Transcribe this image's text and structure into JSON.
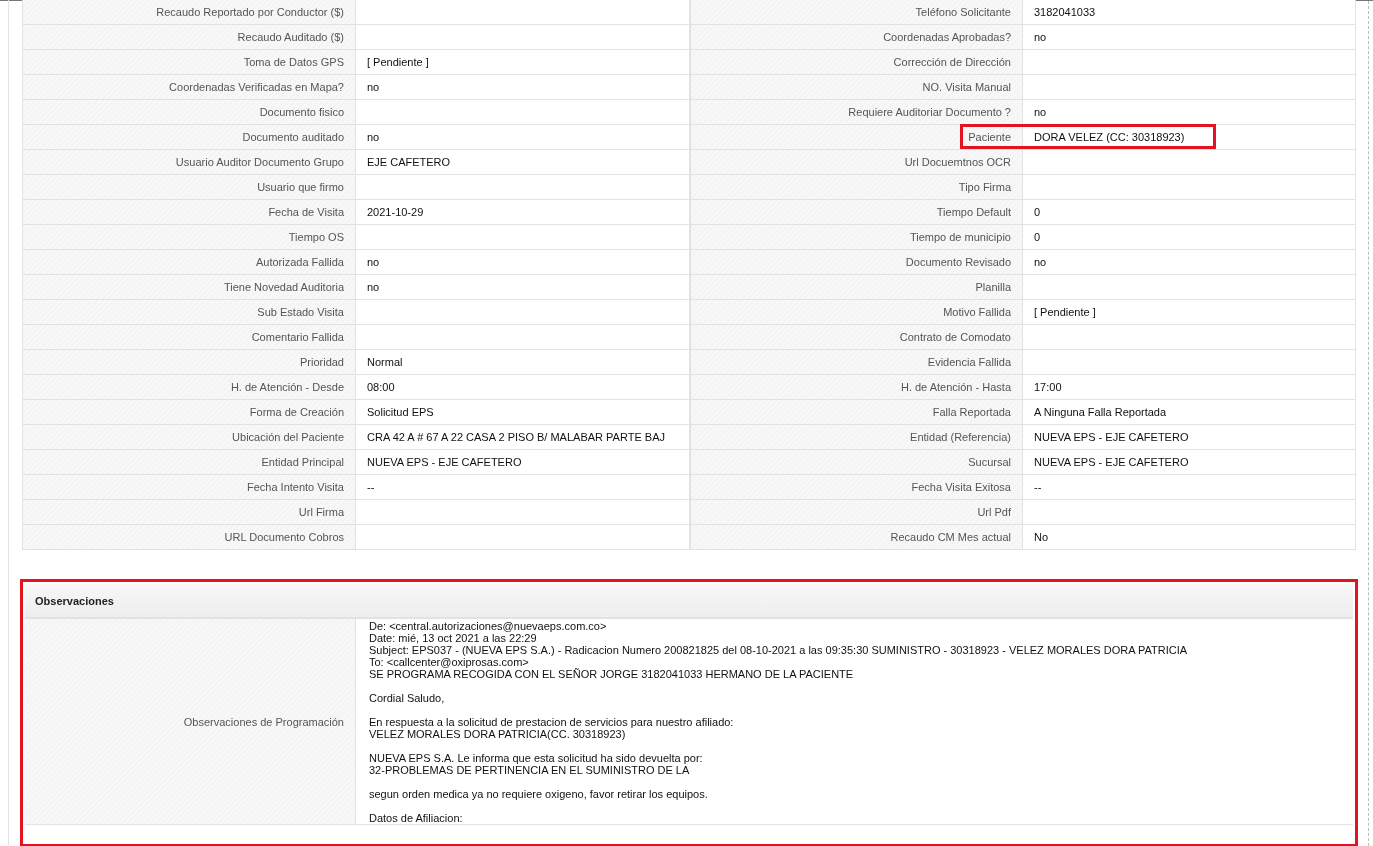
{
  "details": {
    "rows": [
      {
        "left": {
          "label": "Recaudo Reportado por Conductor ($)"
        },
        "right": {
          "label": "Teléfono Solicitante",
          "value": "3182041033"
        }
      },
      {
        "left": {
          "label": "Recaudo Auditado ($)"
        },
        "right": {
          "label": "Coordenadas Aprobadas?",
          "value": "no"
        }
      },
      {
        "left": {
          "label": "Toma de Datos GPS",
          "value": "[ Pendiente ]"
        },
        "right": {
          "label": "Corrección de Dirección"
        }
      },
      {
        "left": {
          "label": "Coordenadas Verificadas en Mapa?",
          "value": "no"
        },
        "right": {
          "label": "NO. Visita Manual"
        }
      },
      {
        "left": {
          "label": "Documento fisico"
        },
        "right": {
          "label": "Requiere Auditoriar Documento ?",
          "value": "no"
        }
      },
      {
        "left": {
          "label": "Documento auditado",
          "value": "no"
        },
        "right": {
          "label": "Paciente",
          "value": "DORA VELEZ (CC: 30318923)",
          "highlighted": true
        }
      },
      {
        "left": {
          "label": "Usuario Auditor Documento Grupo",
          "value": "EJE CAFETERO"
        },
        "right": {
          "label": "Url Docuemtnos OCR"
        }
      },
      {
        "left": {
          "label": "Usuario que firmo"
        },
        "right": {
          "label": "Tipo Firma"
        }
      },
      {
        "left": {
          "label": "Fecha de Visita",
          "value": "2021-10-29"
        },
        "right": {
          "label": "Tiempo Default",
          "value": "0"
        }
      },
      {
        "left": {
          "label": "Tiempo OS"
        },
        "right": {
          "label": "Tiempo de municipio",
          "value": "0"
        }
      },
      {
        "left": {
          "label": "Autorizada Fallida",
          "value": "no"
        },
        "right": {
          "label": "Documento Revisado",
          "value": "no"
        }
      },
      {
        "left": {
          "label": "Tiene Novedad Auditoria",
          "value": "no"
        },
        "right": {
          "label": "Planilla"
        }
      },
      {
        "left": {
          "label": "Sub Estado Visita"
        },
        "right": {
          "label": "Motivo Fallida",
          "value": "[ Pendiente ]"
        }
      },
      {
        "left": {
          "label": "Comentario Fallida"
        },
        "right": {
          "label": "Contrato de Comodato"
        }
      },
      {
        "left": {
          "label": "Prioridad",
          "value": "Normal"
        },
        "right": {
          "label": "Evidencia Fallida"
        }
      },
      {
        "left": {
          "label": "H. de Atención - Desde",
          "value": "08:00"
        },
        "right": {
          "label": "H. de Atención - Hasta",
          "value": "17:00"
        }
      },
      {
        "left": {
          "label": "Forma de Creación",
          "value": "Solicitud EPS"
        },
        "right": {
          "label": "Falla Reportada",
          "value": "A Ninguna Falla Reportada"
        }
      },
      {
        "left": {
          "label": "Ubicación del Paciente",
          "value": "CRA 42 A # 67 A 22 CASA 2 PISO B/ MALABAR PARTE BAJ"
        },
        "right": {
          "label": "Entidad (Referencia)",
          "value": "NUEVA EPS - EJE CAFETERO"
        }
      },
      {
        "left": {
          "label": "Entidad Principal",
          "value": "NUEVA EPS - EJE CAFETERO"
        },
        "right": {
          "label": "Sucursal",
          "value": "NUEVA EPS - EJE CAFETERO"
        }
      },
      {
        "left": {
          "label": "Fecha Intento Visita",
          "value": "--"
        },
        "right": {
          "label": "Fecha Visita Exitosa",
          "value": "--"
        }
      },
      {
        "left": {
          "label": "Url Firma"
        },
        "right": {
          "label": "Url Pdf"
        }
      },
      {
        "left": {
          "label": "URL Documento Cobros"
        },
        "right": {
          "label": "Recaudo CM Mes actual",
          "value": "No"
        }
      }
    ]
  },
  "observations": {
    "title": "Observaciones",
    "highlighted": true,
    "label": "Observaciones de Programación",
    "paragraphs": [
      [
        "De: <central.autorizaciones@nuevaeps.com.co>",
        "Date: mié, 13 oct 2021 a las 22:29",
        "Subject: EPS037 - (NUEVA EPS S.A.) - Radicacion Numero 200821825 del 08-10-2021 a las 09:35:30 SUMINISTRO - 30318923 - VELEZ MORALES DORA PATRICIA",
        "To: <callcenter@oxiprosas.com>",
        "SE PROGRAMA RECOGIDA CON EL SEÑOR JORGE 3182041033 HERMANO DE LA PACIENTE"
      ],
      [
        "Cordial Saludo,"
      ],
      [
        "En respuesta a la solicitud de prestacion de servicios para nuestro afiliado:",
        "VELEZ MORALES DORA PATRICIA(CC. 30318923)"
      ],
      [
        "NUEVA EPS S.A. Le informa que esta solicitud ha sido devuelta por:",
        "32-PROBLEMAS DE PERTINENCIA EN EL SUMINISTRO DE LA"
      ],
      [
        "segun orden medica ya no requiere oxigeno, favor retirar los equipos."
      ],
      [
        "Datos de Afiliacion:"
      ]
    ]
  }
}
